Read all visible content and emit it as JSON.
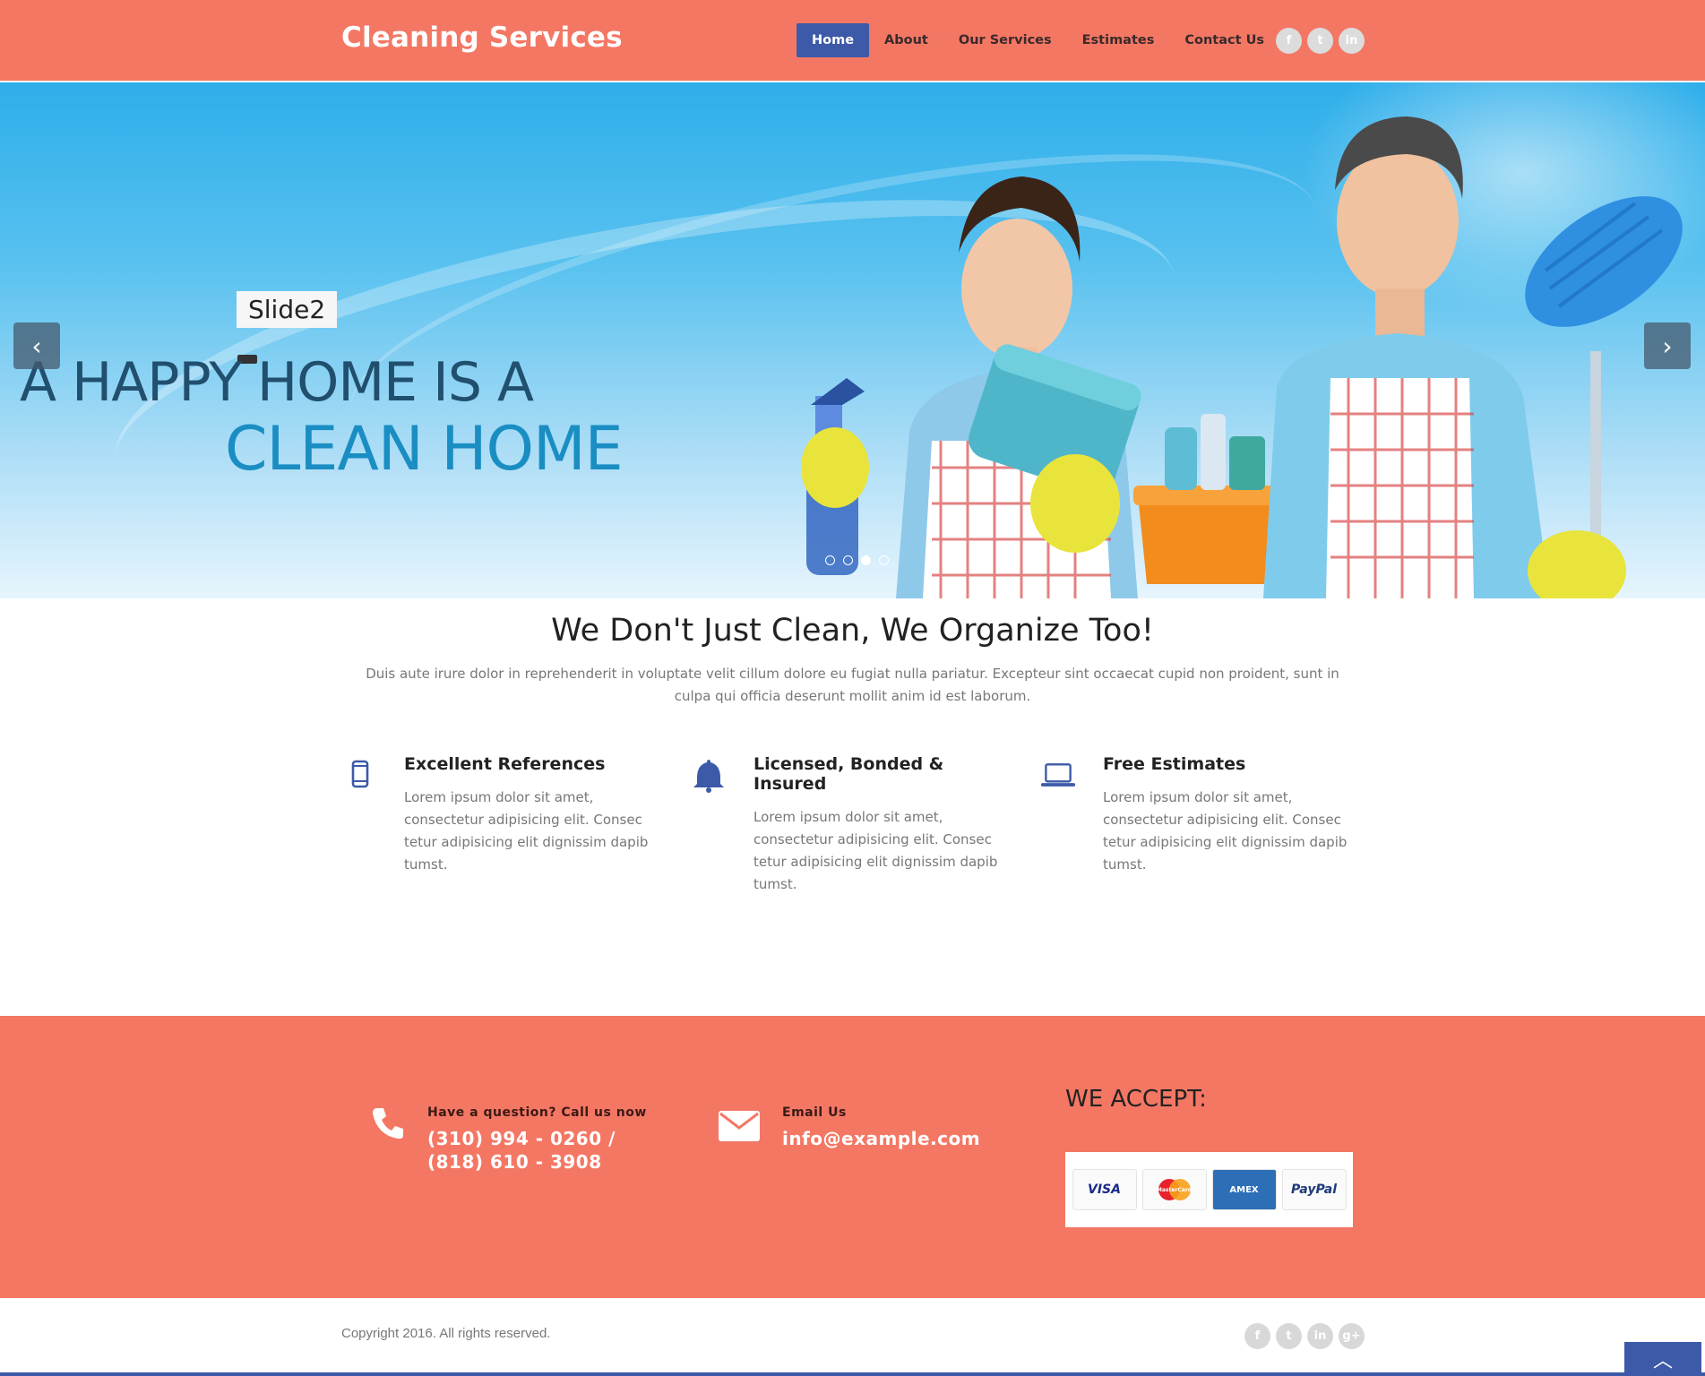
{
  "header": {
    "brand": "Cleaning Services",
    "nav": [
      "Home",
      "About",
      "Our Services",
      "Estimates",
      "Contact Us"
    ],
    "active_nav": "Home",
    "social": [
      "f",
      "t",
      "in"
    ],
    "social_icons": [
      "facebook-icon",
      "twitter-icon",
      "linkedin-icon"
    ]
  },
  "hero": {
    "caption": "Slide2",
    "headline_line1": "A HAPPY HOME IS A",
    "headline_line2": "CLEAN HOME",
    "prev_icon": "chevron-left-icon",
    "next_icon": "chevron-right-icon",
    "prev_glyph": "‹",
    "next_glyph": "›",
    "slide_count": 4,
    "active_slide": 3
  },
  "intro": {
    "title": "We Don't Just Clean, We Organize Too!",
    "text": "Duis aute irure dolor in reprehenderit in voluptate velit cillum dolore eu fugiat nulla pariatur. Excepteur sint occaecat cupid non proident, sunt in culpa qui officia deserunt mollit anim id est laborum."
  },
  "features": [
    {
      "title": "Excellent References",
      "text": "Lorem ipsum dolor sit amet, consectetur adipisicing elit. Consec tetur adipisicing elit dignissim dapib tumst.",
      "icon": "mobile-phone-icon"
    },
    {
      "title": "Licensed, Bonded & Insured",
      "text": "Lorem ipsum dolor sit amet, consectetur adipisicing elit. Consec tetur adipisicing elit dignissim dapib tumst.",
      "icon": "bell-icon"
    },
    {
      "title": "Free Estimates",
      "text": "Lorem ipsum dolor sit amet, consectetur adipisicing elit. Consec tetur adipisicing elit dignissim dapib tumst.",
      "icon": "laptop-icon"
    }
  ],
  "contact": {
    "phone_label": "Have a question? Call us now",
    "phone_value": "(310) 994 - 0260 / (818) 610 - 3908",
    "email_label": "Email Us",
    "email_value": "info@example.com",
    "accept_title": "WE ACCEPT:",
    "cards": [
      "VISA",
      "MasterCard",
      "AMEX",
      "PayPal"
    ]
  },
  "footer": {
    "copyright": "Copyright 2016. All rights reserved.",
    "social": [
      "f",
      "t",
      "in",
      "g+"
    ],
    "social_icons": [
      "facebook-icon",
      "twitter-icon",
      "linkedin-icon",
      "google-plus-icon"
    ],
    "to_top_glyph": "︿"
  },
  "colors": {
    "brand_coral": "#f47764",
    "accent_blue": "#3d5aa8",
    "text_gray": "#777777"
  }
}
